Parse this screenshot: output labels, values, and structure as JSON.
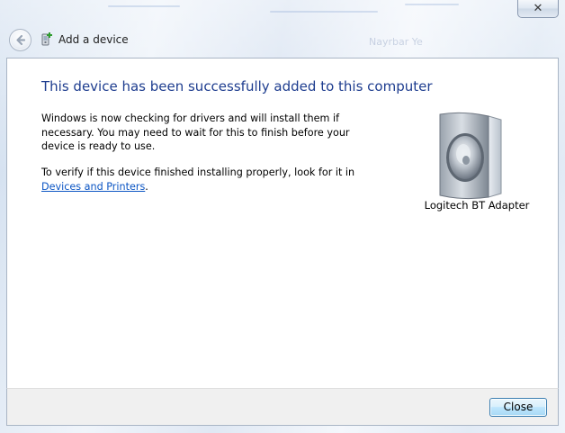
{
  "window": {
    "close_glyph": "✕",
    "header_title": "Add a device",
    "background_link_blur": "Nayrbar Ye"
  },
  "content": {
    "heading": "This device has been successfully added to this computer",
    "paragraph1": "Windows is now checking for drivers and will install them if necessary. You may need to wait for this to finish before your device is ready to use.",
    "paragraph2_prefix": "To verify if this device finished installing properly, look for it in",
    "paragraph2_link": "Devices and Printers",
    "paragraph2_suffix": ".",
    "device_name": "Logitech BT Adapter",
    "device_icon": "speaker-icon"
  },
  "footer": {
    "close_label": "Close"
  },
  "colors": {
    "heading": "#1e3d8f",
    "link": "#0b55c4",
    "button_border": "#3c7fb1"
  }
}
